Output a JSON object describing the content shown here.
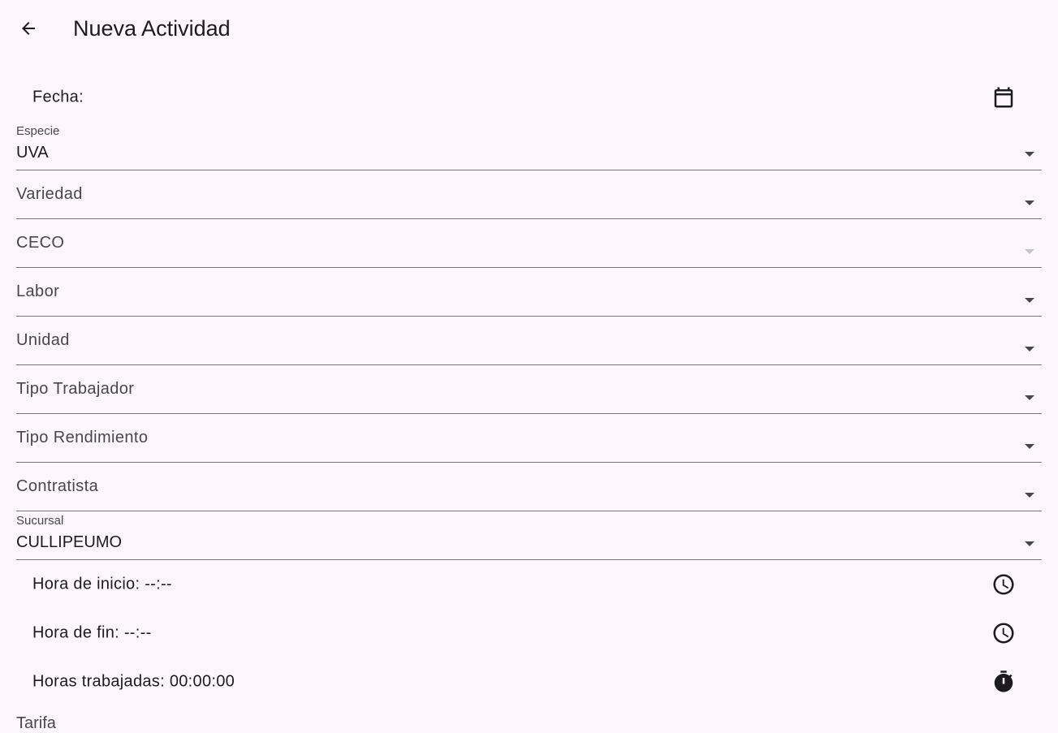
{
  "appbar": {
    "title": "Nueva Actividad",
    "back_icon": "arrow-back-icon"
  },
  "fecha": {
    "label": "Fecha:",
    "icon": "calendar-icon"
  },
  "fields": {
    "especie": {
      "label": "Especie",
      "value": "UVA"
    },
    "variedad": {
      "label": "Variedad"
    },
    "ceco": {
      "label": "CECO",
      "disabled": true
    },
    "labor": {
      "label": "Labor"
    },
    "unidad": {
      "label": "Unidad"
    },
    "tipo_trabajador": {
      "label": "Tipo Trabajador"
    },
    "tipo_rendimiento": {
      "label": "Tipo Rendimiento"
    },
    "contratista": {
      "label": "Contratista"
    },
    "sucursal": {
      "label": "Sucursal",
      "value": "CULLIPEUMO"
    }
  },
  "times": {
    "inicio": {
      "label": "Hora de inicio: --:--",
      "icon": "clock-icon"
    },
    "fin": {
      "label": "Hora de fin: --:--",
      "icon": "clock-icon"
    },
    "trabajadas": {
      "label": "Horas trabajadas: 00:00:00",
      "icon": "timer-icon"
    }
  },
  "partial_next_label": "Tarifa",
  "colors": {
    "background": "#fdf7fd",
    "text": "#1d1b20",
    "secondary_text": "#49454f",
    "underline": "#79747e",
    "disabled_arrow": "#c6c3ca"
  }
}
